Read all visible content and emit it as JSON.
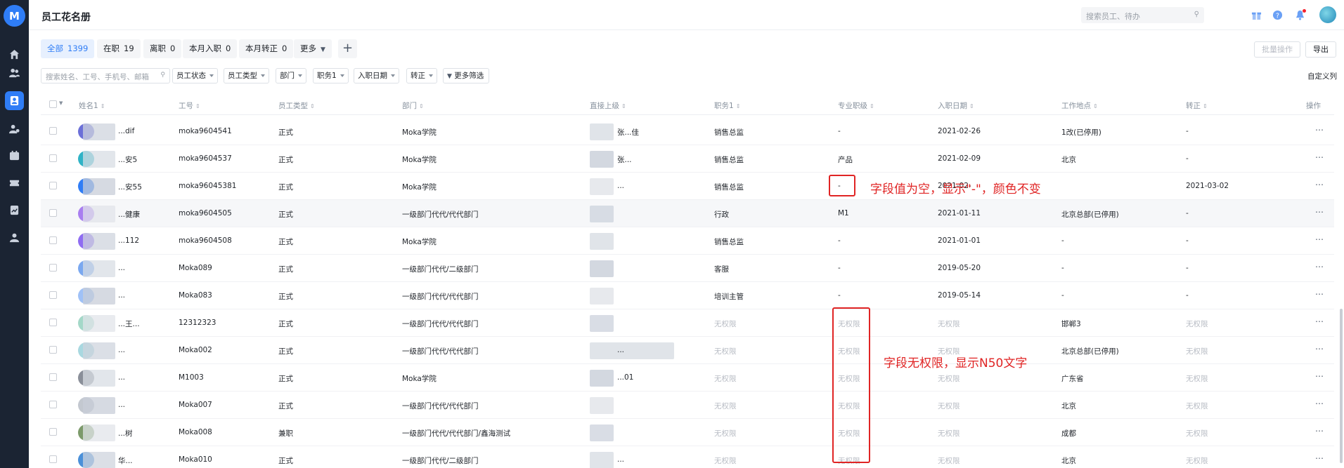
{
  "header": {
    "title": "员工花名册",
    "search_placeholder": "搜索员工、待办"
  },
  "tabs": [
    {
      "label": "全部",
      "count": "1399"
    },
    {
      "label": "在职",
      "count": "19"
    },
    {
      "label": "离职",
      "count": "0"
    },
    {
      "label": "本月入职",
      "count": "0"
    },
    {
      "label": "本月转正",
      "count": "0"
    },
    {
      "label": "更多",
      "count": ""
    }
  ],
  "actions": {
    "batch": "批量操作",
    "export": "导出",
    "column_config": "自定义列"
  },
  "filters": {
    "search_placeholder": "搜索姓名、工号、手机号、邮箱",
    "items": [
      "员工状态",
      "员工类型",
      "部门",
      "职务1",
      "入职日期",
      "转正"
    ],
    "more": "更多筛选"
  },
  "table": {
    "columns": [
      "姓名1",
      "工号",
      "员工类型",
      "部门",
      "直接上级",
      "职务1",
      "专业职级",
      "入职日期",
      "工作地点",
      "转正",
      "操作"
    ],
    "rows": [
      {
        "name": "...dif",
        "id": "moka9604541",
        "type": "正式",
        "dept": "Moka学院",
        "manager": "张...佳",
        "title": "销售总监",
        "rank": "-",
        "date": "2021-02-26",
        "location": "1改(已停用)",
        "probation": "-"
      },
      {
        "name": "...安5",
        "id": "moka9604537",
        "type": "正式",
        "dept": "Moka学院",
        "manager": "张...",
        "title": "销售总监",
        "rank": "产品",
        "date": "2021-02-09",
        "location": "北京",
        "probation": "-"
      },
      {
        "name": "...安55",
        "id": "moka96045381",
        "type": "正式",
        "dept": "Moka学院",
        "manager": "...",
        "title": "销售总监",
        "rank": "-",
        "date": "2021-02-",
        "location": "",
        "probation": "2021-03-02"
      },
      {
        "name": "...健康",
        "id": "moka9604505",
        "type": "正式",
        "dept": "一级部门代代/代代部门",
        "manager": "",
        "title": "行政",
        "rank": "M1",
        "date": "2021-01-11",
        "location": "北京总部(已停用)",
        "probation": "-"
      },
      {
        "name": "...112",
        "id": "moka9604508",
        "type": "正式",
        "dept": "Moka学院",
        "manager": "",
        "title": "销售总监",
        "rank": "-",
        "date": "2021-01-01",
        "location": "-",
        "probation": "-"
      },
      {
        "name": "...",
        "id": "Moka089",
        "type": "正式",
        "dept": "一级部门代代/二级部门",
        "manager": "",
        "title": "客服",
        "rank": "-",
        "date": "2019-05-20",
        "location": "-",
        "probation": "-"
      },
      {
        "name": "...",
        "id": "Moka083",
        "type": "正式",
        "dept": "一级部门代代/代代部门",
        "manager": "",
        "title": "培训主管",
        "rank": "-",
        "date": "2019-05-14",
        "location": "-",
        "probation": "-"
      },
      {
        "name": "...王...",
        "id": "12312323",
        "type": "正式",
        "dept": "一级部门代代/代代部门",
        "manager": "",
        "title": "无权限",
        "rank": "无权限",
        "date": "无权限",
        "location": "邯郸3",
        "probation": "无权限"
      },
      {
        "name": "...",
        "id": "Moka002",
        "type": "正式",
        "dept": "一级部门代代/代代部门",
        "manager": "...",
        "title": "无权限",
        "rank": "无权限",
        "date": "无权限",
        "location": "北京总部(已停用)",
        "probation": "无权限"
      },
      {
        "name": "...",
        "id": "M1003",
        "type": "正式",
        "dept": "Moka学院",
        "manager": "...01",
        "title": "无权限",
        "rank": "无权限",
        "date": "无权限",
        "location": "广东省",
        "probation": "无权限"
      },
      {
        "name": "...",
        "id": "Moka007",
        "type": "正式",
        "dept": "一级部门代代/代代部门",
        "manager": "",
        "title": "无权限",
        "rank": "无权限",
        "date": "无权限",
        "location": "北京",
        "probation": "无权限"
      },
      {
        "name": "...树",
        "id": "Moka008",
        "type": "兼职",
        "dept": "一级部门代代/代代部门/鑫海测试",
        "manager": "",
        "title": "无权限",
        "rank": "无权限",
        "date": "无权限",
        "location": "成都",
        "probation": "无权限"
      },
      {
        "name": "华...",
        "id": "Moka010",
        "type": "正式",
        "dept": "一级部门代代/二级部门",
        "manager": "...",
        "title": "无权限",
        "rank": "无权限",
        "date": "无权限",
        "location": "北京",
        "probation": "无权限"
      }
    ]
  },
  "annotations": {
    "empty_value": "字段值为空，显示\"-\"，颜色不变",
    "no_permission": "字段无权限，显示N50文字"
  },
  "colors": {
    "accent": "#2f7df6",
    "annotation": "#e02424",
    "muted_text": "#b8bcc4",
    "nav_bg": "#1b2433"
  }
}
